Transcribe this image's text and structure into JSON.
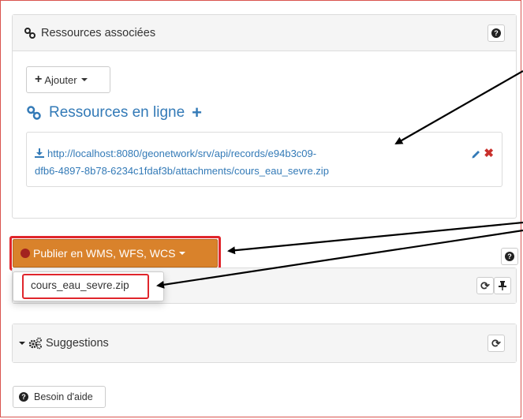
{
  "resources_panel": {
    "title": "Ressources associées",
    "add_button_label": "Ajouter",
    "online_heading": "Ressources en ligne",
    "resource_link_line1": "http://localhost:8080/geonetwork/srv/api/records/e94b3c09-",
    "resource_link_line2": "dfb6-4897-8b78-6234c1fdaf3b/attachments/cours_eau_sevre.zip"
  },
  "publish_button": {
    "label": "Publier en WMS, WFS, WCS"
  },
  "publish_dropdown": {
    "item": "cours_eau_sevre.zip"
  },
  "suggestions_panel": {
    "title": "Suggestions"
  },
  "help_button": {
    "label": "Besoin d'aide"
  },
  "colors": {
    "callout_red": "#e0262c",
    "publish_orange": "#d9822b",
    "link_blue": "#337ab7",
    "delete_red": "#c9302c"
  },
  "icons": [
    "link-icon",
    "help-icon",
    "plus-icon",
    "download-icon",
    "edit-icon",
    "delete-icon",
    "globe-icon",
    "refresh-icon",
    "pin-icon",
    "chevron-down-icon",
    "cogs-icon"
  ]
}
